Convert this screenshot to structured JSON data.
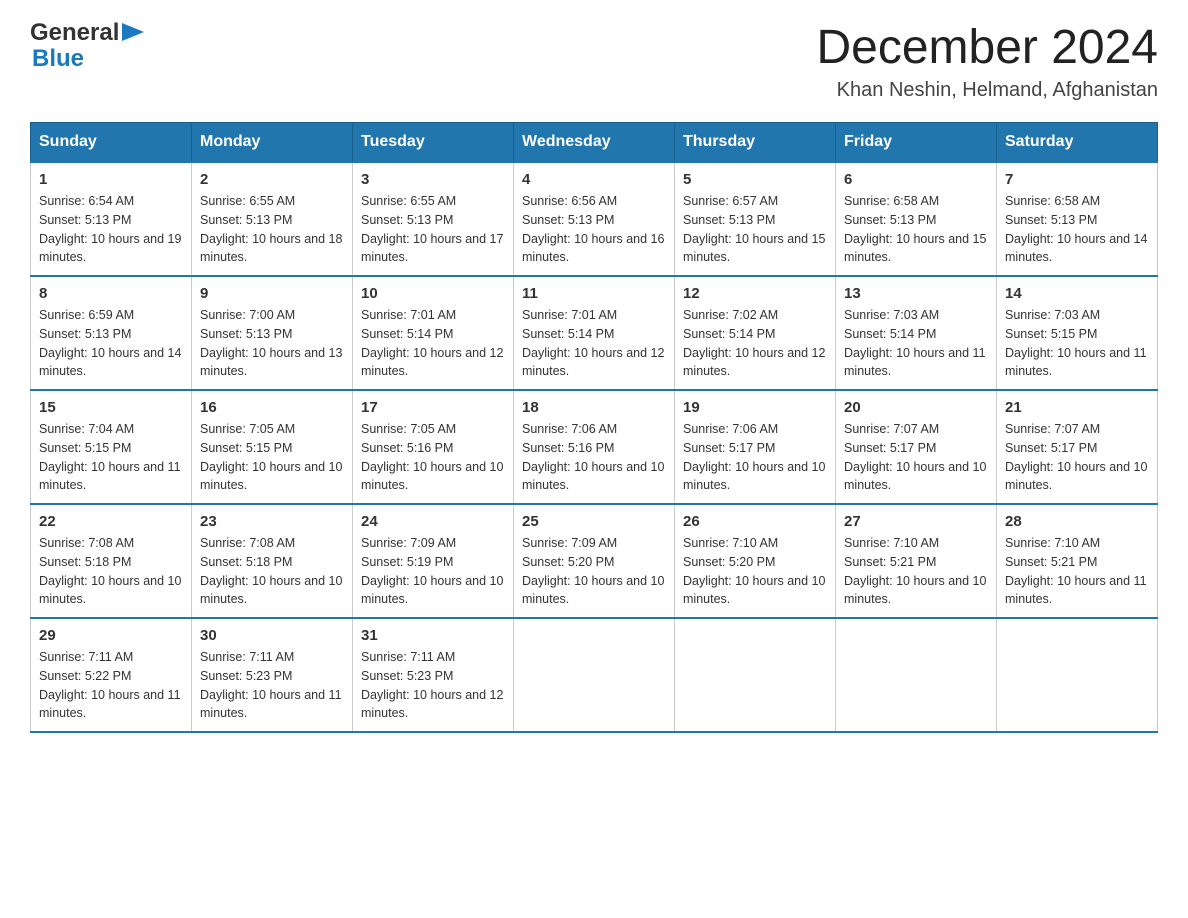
{
  "header": {
    "logo_text_general": "General",
    "logo_text_blue": "Blue",
    "main_title": "December 2024",
    "subtitle": "Khan Neshin, Helmand, Afghanistan"
  },
  "calendar": {
    "days_of_week": [
      "Sunday",
      "Monday",
      "Tuesday",
      "Wednesday",
      "Thursday",
      "Friday",
      "Saturday"
    ],
    "weeks": [
      [
        {
          "day": "1",
          "sunrise": "6:54 AM",
          "sunset": "5:13 PM",
          "daylight": "10 hours and 19 minutes."
        },
        {
          "day": "2",
          "sunrise": "6:55 AM",
          "sunset": "5:13 PM",
          "daylight": "10 hours and 18 minutes."
        },
        {
          "day": "3",
          "sunrise": "6:55 AM",
          "sunset": "5:13 PM",
          "daylight": "10 hours and 17 minutes."
        },
        {
          "day": "4",
          "sunrise": "6:56 AM",
          "sunset": "5:13 PM",
          "daylight": "10 hours and 16 minutes."
        },
        {
          "day": "5",
          "sunrise": "6:57 AM",
          "sunset": "5:13 PM",
          "daylight": "10 hours and 15 minutes."
        },
        {
          "day": "6",
          "sunrise": "6:58 AM",
          "sunset": "5:13 PM",
          "daylight": "10 hours and 15 minutes."
        },
        {
          "day": "7",
          "sunrise": "6:58 AM",
          "sunset": "5:13 PM",
          "daylight": "10 hours and 14 minutes."
        }
      ],
      [
        {
          "day": "8",
          "sunrise": "6:59 AM",
          "sunset": "5:13 PM",
          "daylight": "10 hours and 14 minutes."
        },
        {
          "day": "9",
          "sunrise": "7:00 AM",
          "sunset": "5:13 PM",
          "daylight": "10 hours and 13 minutes."
        },
        {
          "day": "10",
          "sunrise": "7:01 AM",
          "sunset": "5:14 PM",
          "daylight": "10 hours and 12 minutes."
        },
        {
          "day": "11",
          "sunrise": "7:01 AM",
          "sunset": "5:14 PM",
          "daylight": "10 hours and 12 minutes."
        },
        {
          "day": "12",
          "sunrise": "7:02 AM",
          "sunset": "5:14 PM",
          "daylight": "10 hours and 12 minutes."
        },
        {
          "day": "13",
          "sunrise": "7:03 AM",
          "sunset": "5:14 PM",
          "daylight": "10 hours and 11 minutes."
        },
        {
          "day": "14",
          "sunrise": "7:03 AM",
          "sunset": "5:15 PM",
          "daylight": "10 hours and 11 minutes."
        }
      ],
      [
        {
          "day": "15",
          "sunrise": "7:04 AM",
          "sunset": "5:15 PM",
          "daylight": "10 hours and 11 minutes."
        },
        {
          "day": "16",
          "sunrise": "7:05 AM",
          "sunset": "5:15 PM",
          "daylight": "10 hours and 10 minutes."
        },
        {
          "day": "17",
          "sunrise": "7:05 AM",
          "sunset": "5:16 PM",
          "daylight": "10 hours and 10 minutes."
        },
        {
          "day": "18",
          "sunrise": "7:06 AM",
          "sunset": "5:16 PM",
          "daylight": "10 hours and 10 minutes."
        },
        {
          "day": "19",
          "sunrise": "7:06 AM",
          "sunset": "5:17 PM",
          "daylight": "10 hours and 10 minutes."
        },
        {
          "day": "20",
          "sunrise": "7:07 AM",
          "sunset": "5:17 PM",
          "daylight": "10 hours and 10 minutes."
        },
        {
          "day": "21",
          "sunrise": "7:07 AM",
          "sunset": "5:17 PM",
          "daylight": "10 hours and 10 minutes."
        }
      ],
      [
        {
          "day": "22",
          "sunrise": "7:08 AM",
          "sunset": "5:18 PM",
          "daylight": "10 hours and 10 minutes."
        },
        {
          "day": "23",
          "sunrise": "7:08 AM",
          "sunset": "5:18 PM",
          "daylight": "10 hours and 10 minutes."
        },
        {
          "day": "24",
          "sunrise": "7:09 AM",
          "sunset": "5:19 PM",
          "daylight": "10 hours and 10 minutes."
        },
        {
          "day": "25",
          "sunrise": "7:09 AM",
          "sunset": "5:20 PM",
          "daylight": "10 hours and 10 minutes."
        },
        {
          "day": "26",
          "sunrise": "7:10 AM",
          "sunset": "5:20 PM",
          "daylight": "10 hours and 10 minutes."
        },
        {
          "day": "27",
          "sunrise": "7:10 AM",
          "sunset": "5:21 PM",
          "daylight": "10 hours and 10 minutes."
        },
        {
          "day": "28",
          "sunrise": "7:10 AM",
          "sunset": "5:21 PM",
          "daylight": "10 hours and 11 minutes."
        }
      ],
      [
        {
          "day": "29",
          "sunrise": "7:11 AM",
          "sunset": "5:22 PM",
          "daylight": "10 hours and 11 minutes."
        },
        {
          "day": "30",
          "sunrise": "7:11 AM",
          "sunset": "5:23 PM",
          "daylight": "10 hours and 11 minutes."
        },
        {
          "day": "31",
          "sunrise": "7:11 AM",
          "sunset": "5:23 PM",
          "daylight": "10 hours and 12 minutes."
        },
        null,
        null,
        null,
        null
      ]
    ]
  }
}
